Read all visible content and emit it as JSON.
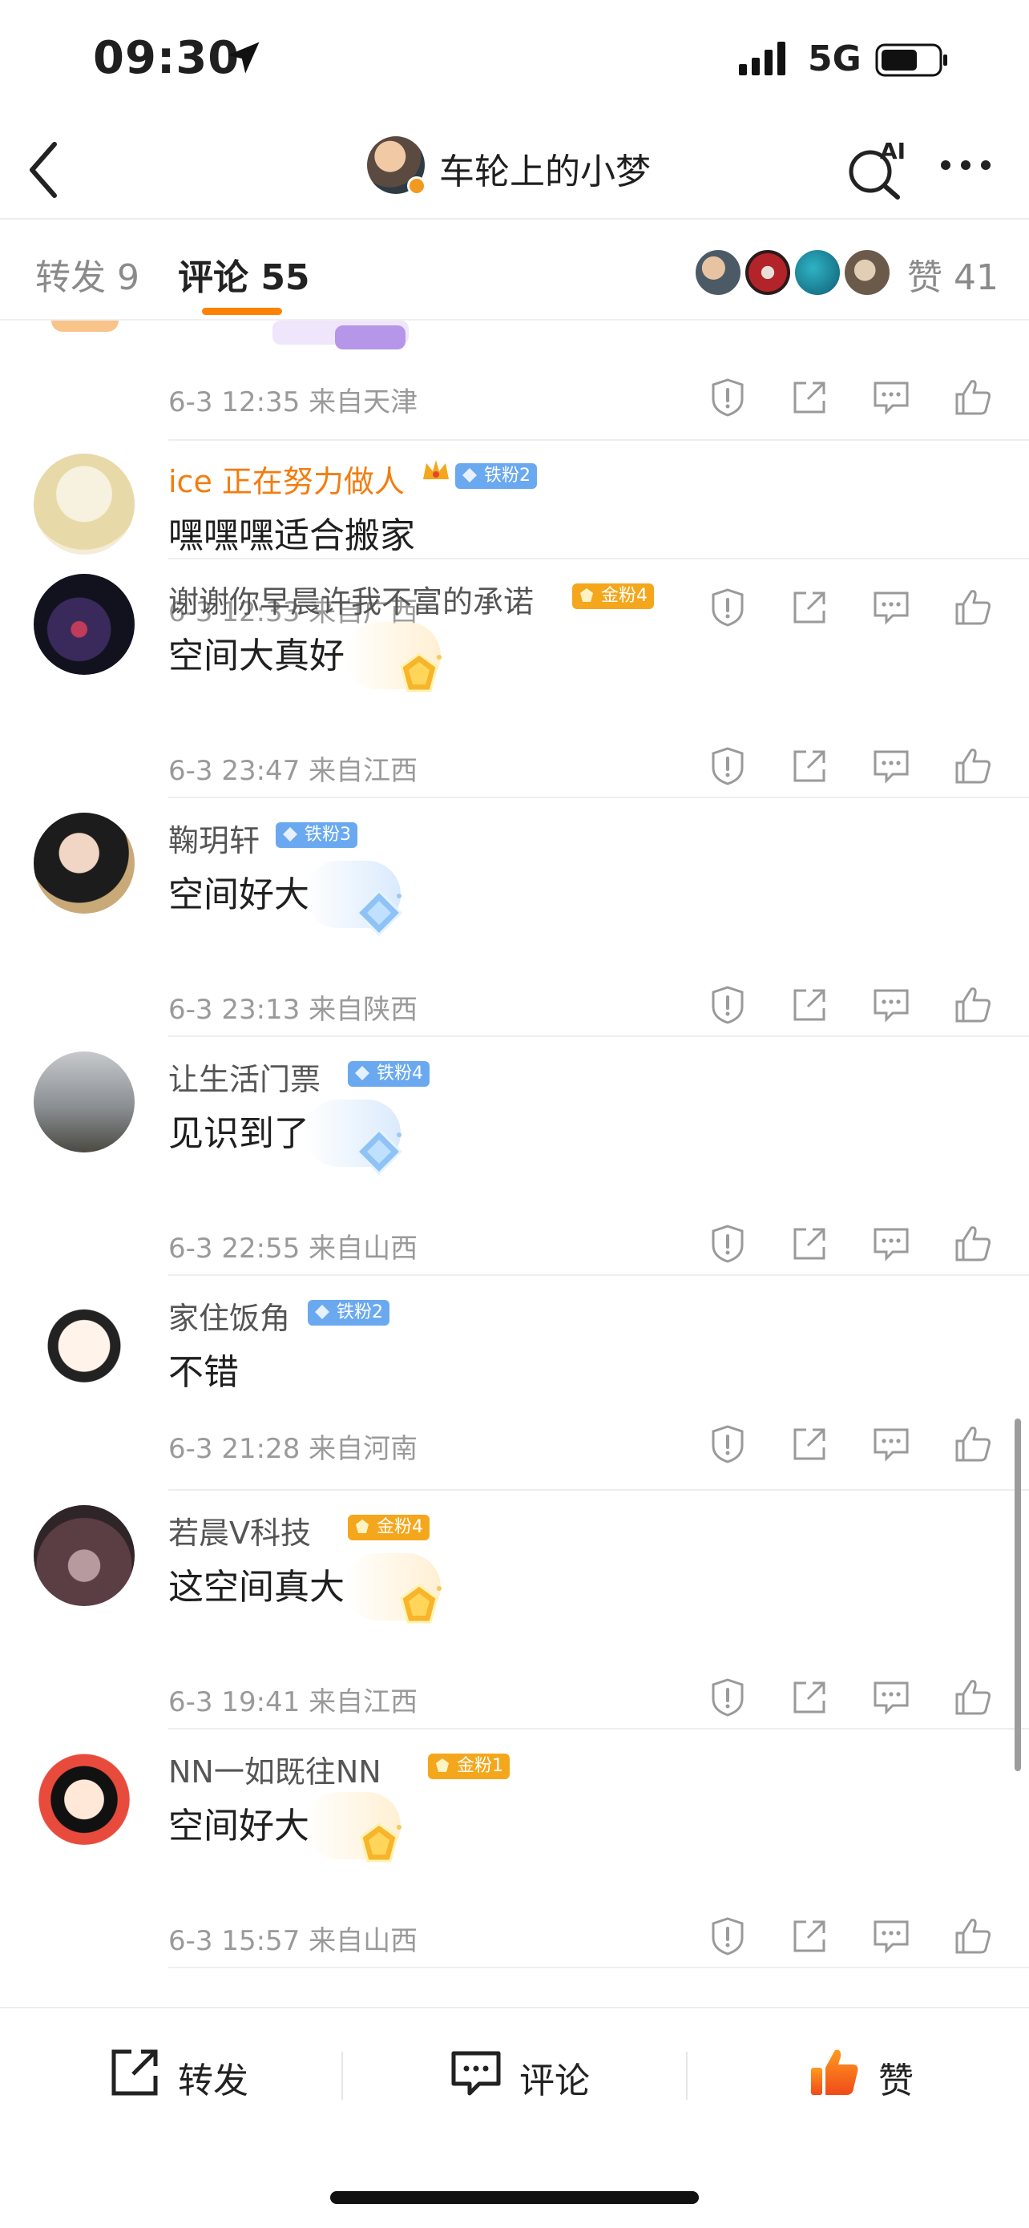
{
  "status_bar": {
    "time": "09:30",
    "network": "5G"
  },
  "header": {
    "title": "车轮上的小梦",
    "ai_label": "AI"
  },
  "tabs": {
    "forward_label": "转发 9",
    "comment_label": "评论 55",
    "likes_label": "赞 41",
    "active": "comment"
  },
  "comments": [
    {
      "user": "ice 正在努力做人",
      "badge": "铁粉2",
      "badge_type": "iron",
      "text": "嘿嘿嘿适合搬家",
      "meta": "6-3 12:33  来自广西"
    },
    {
      "user": "谢谢你早晨许我不富的承诺",
      "badge": "金粉4",
      "badge_type": "gold",
      "text": "空间大真好",
      "meta": "6-3 23:47  来自江西"
    },
    {
      "user": "鞠玥轩",
      "badge": "铁粉3",
      "badge_type": "iron",
      "text": "空间好大",
      "meta": "6-3 23:13  来自陕西"
    },
    {
      "user": "让生活门票",
      "badge": "铁粉4",
      "badge_type": "iron",
      "text": "见识到了",
      "meta": "6-3 22:55  来自山西"
    },
    {
      "user": "家住饭角",
      "badge": "铁粉2",
      "badge_type": "iron",
      "text": "不错",
      "meta": "6-3 21:28  来自河南"
    },
    {
      "user": "若晨Ⅴ科技",
      "badge": "金粉4",
      "badge_type": "gold",
      "text": "这空间真大",
      "meta": "6-3 19:41  来自江西"
    },
    {
      "user": "NN一如既往NN",
      "badge": "金粉1",
      "badge_type": "gold",
      "text": "空间好大",
      "meta": "6-3 15:57  来自山西"
    }
  ],
  "previous_comment_meta": "6-3 12:35  来自天津",
  "bottom_bar": {
    "forward": "转发",
    "comment": "评论",
    "like": "赞"
  },
  "colors": {
    "accent": "#ff8200",
    "iron_badge": "#6aa9ef",
    "gold_badge": "#f4a71c",
    "orange_name": "#f37d0f"
  },
  "icons": [
    "back-arrow-icon",
    "ai-search-icon",
    "more-icon",
    "report-icon",
    "share-icon",
    "reply-icon",
    "like-icon"
  ]
}
